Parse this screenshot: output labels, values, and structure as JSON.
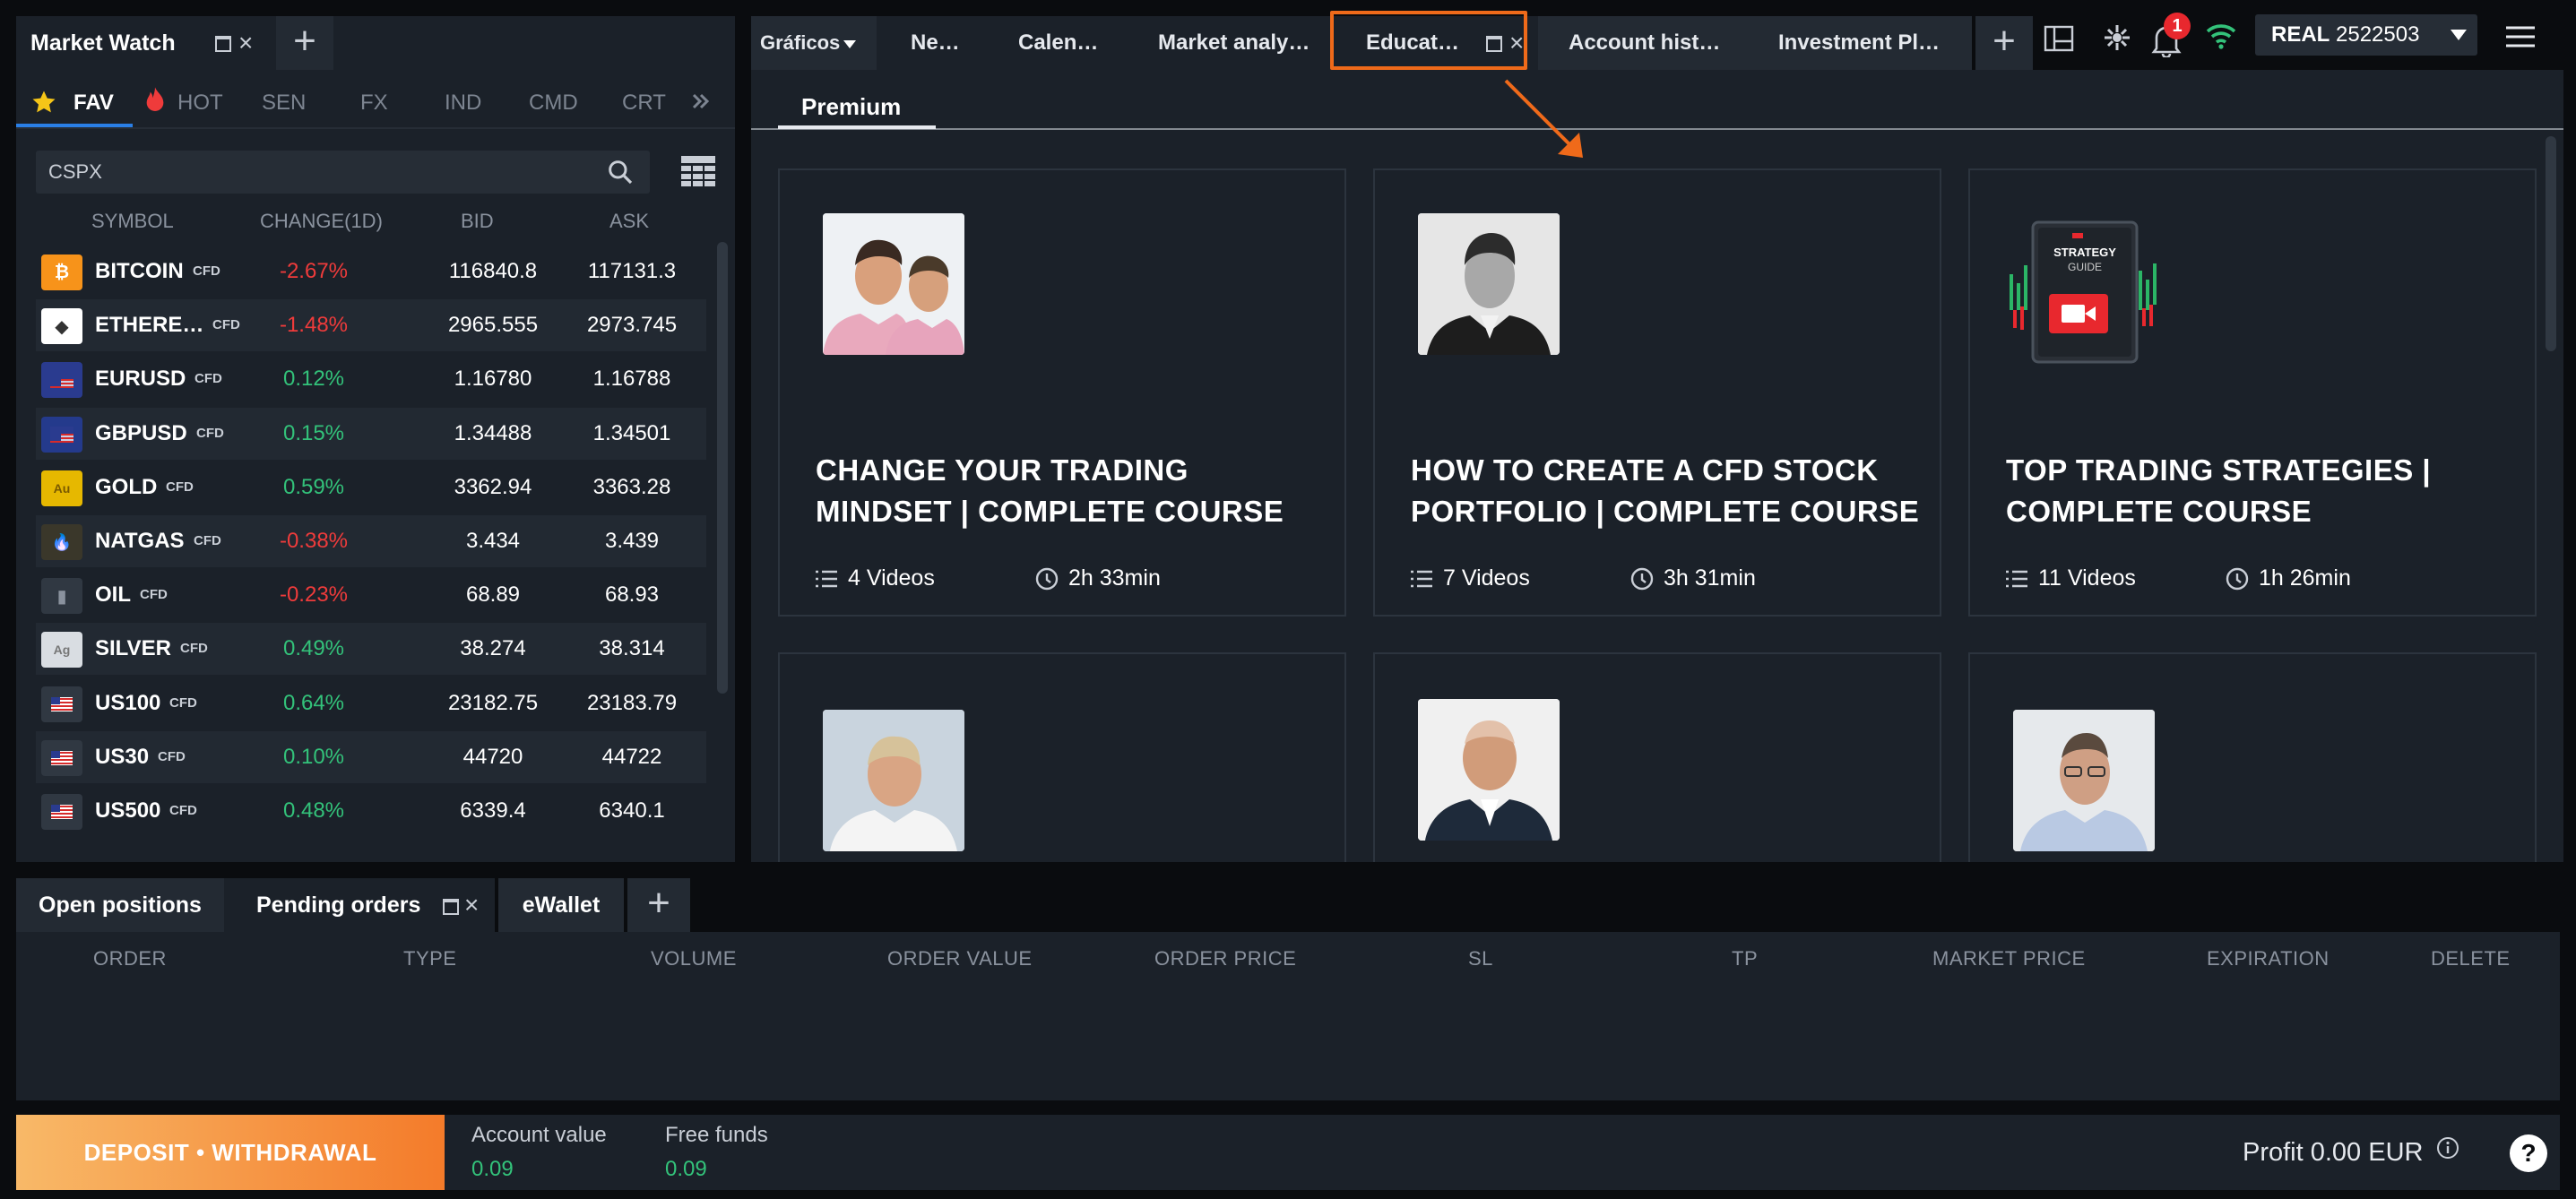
{
  "market_watch": {
    "title": "Market Watch",
    "categories": [
      "FAV",
      "HOT",
      "SEN",
      "FX",
      "IND",
      "CMD",
      "CRT"
    ],
    "search_value": "CSPX",
    "columns": [
      "SYMBOL",
      "CHANGE(1D)",
      "BID",
      "ASK"
    ],
    "rows": [
      {
        "name": "BITCOIN",
        "tag": "CFD",
        "change": "-2.67%",
        "bid": "116840.8",
        "ask": "117131.3",
        "dir": "neg",
        "icon": "bitcoin-icon",
        "color": "#f7931a"
      },
      {
        "name": "ETHERE…",
        "tag": "CFD",
        "change": "-1.48%",
        "bid": "2965.555",
        "ask": "2973.745",
        "dir": "neg",
        "icon": "ethereum-icon",
        "color": "#ffffff"
      },
      {
        "name": "EURUSD",
        "tag": "CFD",
        "change": "0.12%",
        "bid": "1.16780",
        "ask": "1.16788",
        "dir": "pos",
        "icon": "eurusd-flag-icon",
        "color": "#2a3b8f"
      },
      {
        "name": "GBPUSD",
        "tag": "CFD",
        "change": "0.15%",
        "bid": "1.34488",
        "ask": "1.34501",
        "dir": "pos",
        "icon": "gbpusd-flag-icon",
        "color": "#243a8c"
      },
      {
        "name": "GOLD",
        "tag": "CFD",
        "change": "0.59%",
        "bid": "3362.94",
        "ask": "3363.28",
        "dir": "pos",
        "icon": "gold-icon",
        "color": "#e6b800"
      },
      {
        "name": "NATGAS",
        "tag": "CFD",
        "change": "-0.38%",
        "bid": "3.434",
        "ask": "3.439",
        "dir": "neg",
        "icon": "natgas-flame-icon",
        "color": "#303842"
      },
      {
        "name": "OIL",
        "tag": "CFD",
        "change": "-0.23%",
        "bid": "68.89",
        "ask": "68.93",
        "dir": "neg",
        "icon": "oil-barrel-icon",
        "color": "#303842"
      },
      {
        "name": "SILVER",
        "tag": "CFD",
        "change": "0.49%",
        "bid": "38.274",
        "ask": "38.314",
        "dir": "pos",
        "icon": "silver-icon",
        "color": "#d9dde2"
      },
      {
        "name": "US100",
        "tag": "CFD",
        "change": "0.64%",
        "bid": "23182.75",
        "ask": "23183.79",
        "dir": "pos",
        "icon": "us-flag-icon",
        "color": "#303842"
      },
      {
        "name": "US30",
        "tag": "CFD",
        "change": "0.10%",
        "bid": "44720",
        "ask": "44722",
        "dir": "pos",
        "icon": "us-flag-icon",
        "color": "#303842"
      },
      {
        "name": "US500",
        "tag": "CFD",
        "change": "0.48%",
        "bid": "6339.4",
        "ask": "6340.1",
        "dir": "pos",
        "icon": "us-flag-icon",
        "color": "#303842"
      }
    ],
    "gold_icon_text": "Au",
    "silver_icon_text": "Ag"
  },
  "top_tabs": {
    "items": [
      "Gráficos",
      "Ne…",
      "Calen…",
      "Market analy…",
      "Educat…",
      "Account hist…",
      "Investment Pl…"
    ],
    "active": "Educat…"
  },
  "header": {
    "notifications_count": "1",
    "account_type": "REAL",
    "account_number": "2522503"
  },
  "education": {
    "section_tab": "Premium",
    "courses": [
      {
        "title": "CHANGE YOUR TRADING MINDSET | COMPLETE COURSE",
        "videos": "4 Videos",
        "duration": "2h 33min"
      },
      {
        "title": "HOW TO CREATE A CFD STOCK PORTFOLIO | COMPLETE COURSE",
        "videos": "7 Videos",
        "duration": "3h 31min"
      },
      {
        "title": "TOP TRADING STRATEGIES | COMPLETE COURSE",
        "videos": "11 Videos",
        "duration": "1h 26min"
      },
      {
        "title": "",
        "videos": "",
        "duration": ""
      },
      {
        "title": "",
        "videos": "",
        "duration": ""
      },
      {
        "title": "",
        "videos": "",
        "duration": ""
      }
    ],
    "strategy_guide_text": [
      "STRATEGY",
      "GUIDE"
    ]
  },
  "orders": {
    "tabs": [
      "Open positions",
      "Pending orders",
      "eWallet"
    ],
    "active_tab": "Pending orders",
    "columns": [
      "ORDER",
      "TYPE",
      "VOLUME",
      "ORDER VALUE",
      "ORDER PRICE",
      "SL",
      "TP",
      "MARKET PRICE",
      "EXPIRATION",
      "DELETE"
    ]
  },
  "footer": {
    "deposit_label": "DEPOSIT • WITHDRAWAL",
    "account_value_label": "Account value",
    "account_value": "0.09",
    "free_funds_label": "Free funds",
    "free_funds": "0.09",
    "profit": "Profit 0.00 EUR",
    "help": "?"
  },
  "colors": {
    "accent_orange": "#ef6a1a",
    "negative": "#ef3b3b",
    "positive": "#33c27a",
    "panel": "#1b2129"
  }
}
